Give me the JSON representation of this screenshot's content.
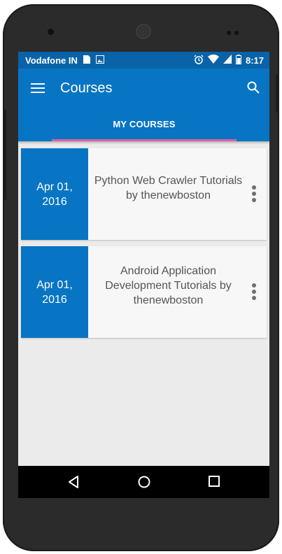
{
  "status_bar": {
    "carrier": "Vodafone IN",
    "time": "8:17",
    "icons": [
      "sim-icon",
      "image-icon",
      "alarm-icon",
      "wifi-icon",
      "signal-icon",
      "battery-icon"
    ]
  },
  "app_bar": {
    "title": "Courses",
    "icons": [
      "menu-icon",
      "search-icon"
    ]
  },
  "tabs": [
    {
      "label": "MY COURSES",
      "selected": true
    }
  ],
  "courses": [
    {
      "date_line1": "Apr 01,",
      "date_line2": "2016",
      "title": "Python Web Crawler Tutorials by thenewboston"
    },
    {
      "date_line1": "Apr 01,",
      "date_line2": "2016",
      "title": "Android Application Development Tutorials by thenewboston"
    }
  ],
  "nav_bar": {
    "icons": [
      "back-icon",
      "home-icon",
      "recents-icon"
    ]
  },
  "colors": {
    "status_bar": "#0a63a8",
    "primary": "#0775c3",
    "tab_indicator": "#e25da3",
    "background": "#ebebeb",
    "card": "#f7f7f7",
    "phone_body": "#2b2b2b"
  }
}
